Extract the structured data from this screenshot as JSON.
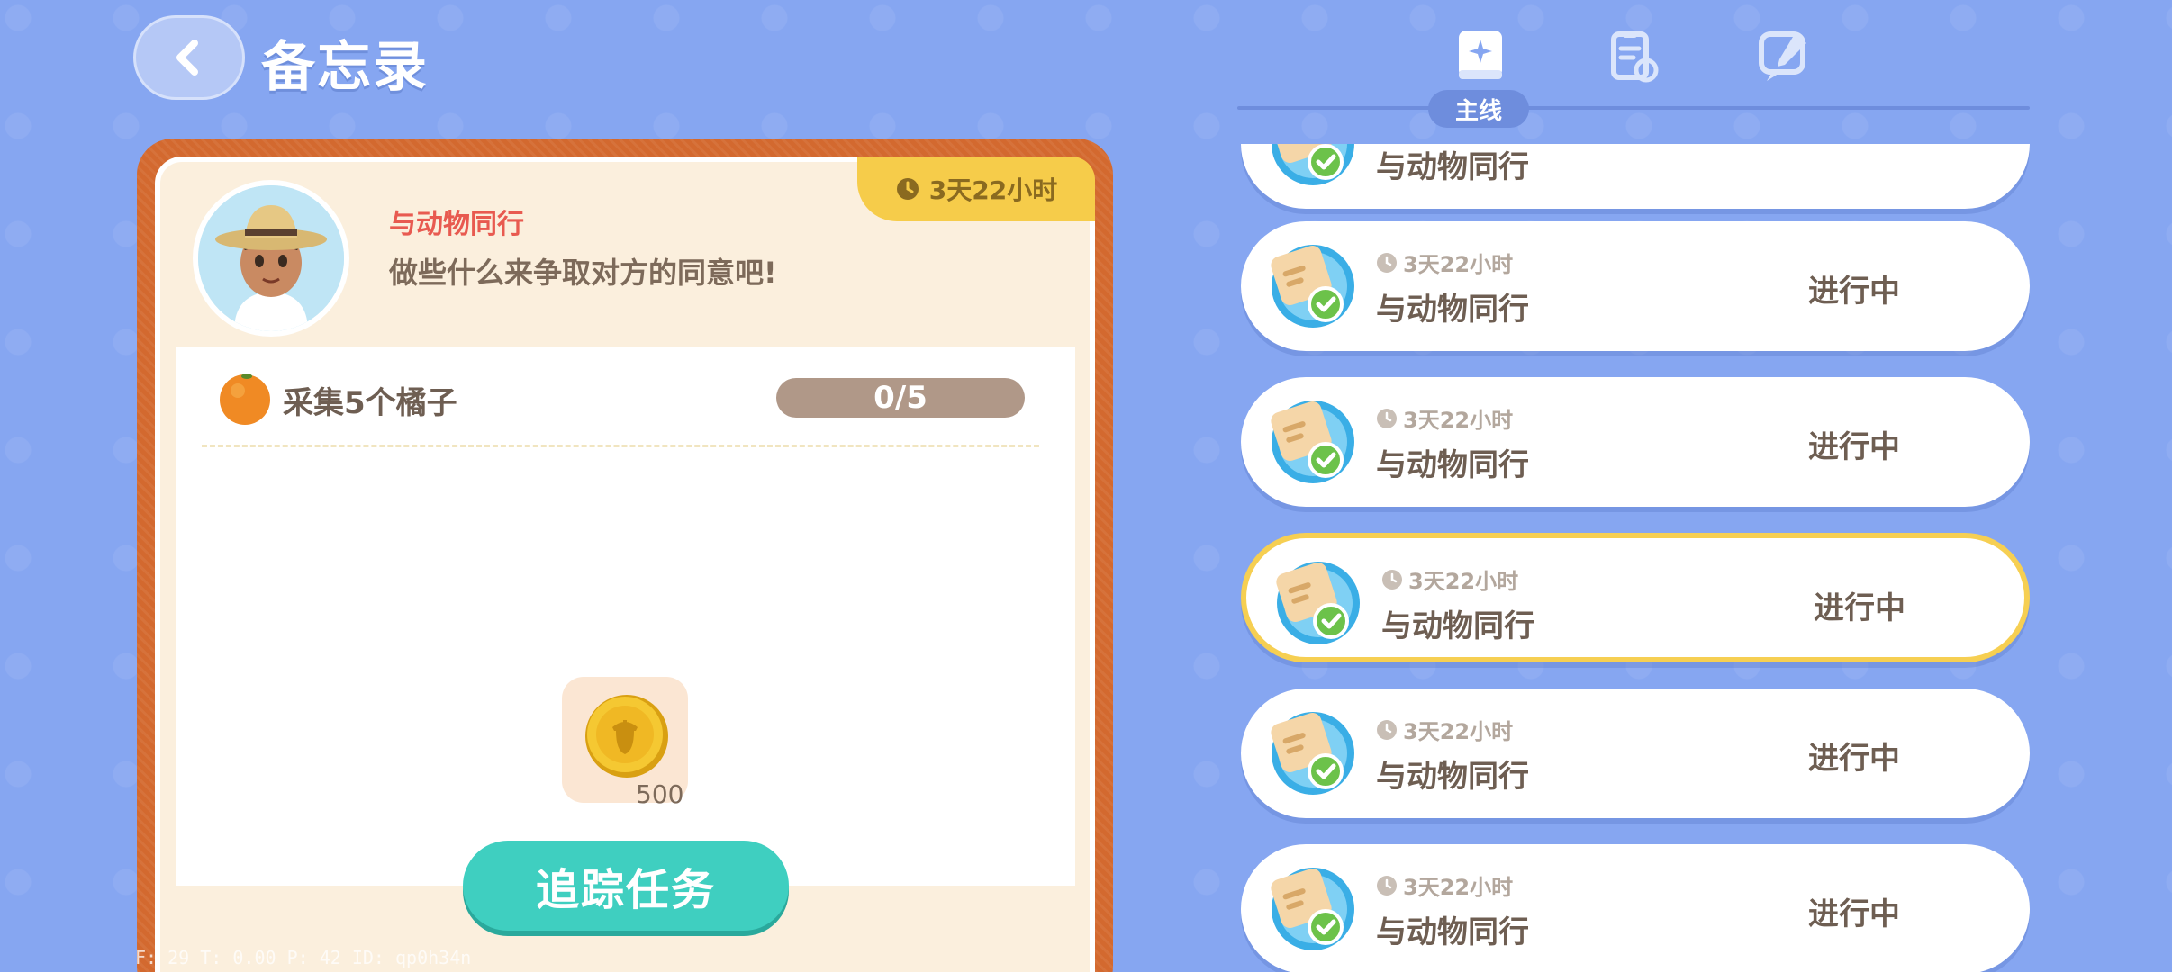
{
  "header": {
    "title": "备忘录"
  },
  "quest_detail": {
    "remaining_time": "3天22小时",
    "name": "与动物同行",
    "description": "做些什么来争取对方的同意吧!",
    "tasks": [
      {
        "text": "采集5个橘子",
        "progress": "0/5"
      }
    ],
    "reward_amount": "500",
    "track_button": "追踪任务"
  },
  "tabs": {
    "active_label": "主线",
    "items": [
      "main-quest-tab",
      "side-quest-tab",
      "event-quest-tab"
    ]
  },
  "quest_list": [
    {
      "time": "3天22小时",
      "name": "与动物同行",
      "status": "进行中",
      "selected": false
    },
    {
      "time": "3天22小时",
      "name": "与动物同行",
      "status": "进行中",
      "selected": false
    },
    {
      "time": "3天22小时",
      "name": "与动物同行",
      "status": "进行中",
      "selected": true
    },
    {
      "time": "3天22小时",
      "name": "与动物同行",
      "status": "进行中",
      "selected": false
    },
    {
      "time": "3天22小时",
      "name": "与动物同行",
      "status": "进行中",
      "selected": false
    }
  ],
  "partial_top_quest_name": "与动物同行",
  "debug": "F: 29    T: 0.00    P: 42    ID: qp0h34n",
  "colors": {
    "background": "#86a6f1",
    "card_border": "#d3692f",
    "track_button": "#3fcfc0",
    "selected_outline": "#f6cf52",
    "quest_name_red": "#e85a50"
  }
}
